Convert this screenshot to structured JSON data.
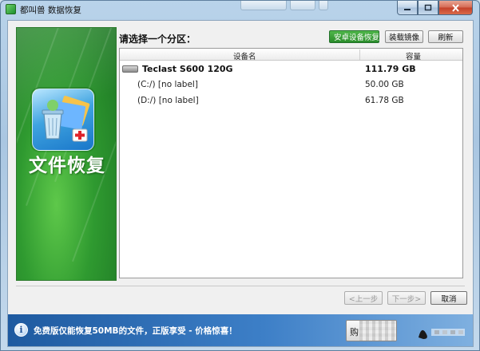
{
  "window": {
    "title": "都叫兽 数据恢复"
  },
  "sidebar": {
    "title": "文件恢复",
    "icon": "recycle-bin-folder-icon"
  },
  "panel": {
    "prompt": "请选择一个分区：",
    "buttons": {
      "android": "安卓设备恢复",
      "load_image": "装载镜像",
      "refresh": "刷新"
    },
    "columns": {
      "device": "设备名",
      "capacity": "容量"
    },
    "rows": [
      {
        "name": "Teclast S600 120G",
        "capacity": "111.79 GB",
        "kind": "disk"
      },
      {
        "name": "(C:/) [no label]",
        "capacity": "50.00 GB",
        "kind": "partition"
      },
      {
        "name": "(D:/) [no label]",
        "capacity": "61.78 GB",
        "kind": "partition"
      }
    ]
  },
  "nav": {
    "prev": "<上一步",
    "next": "下一步>",
    "cancel": "取消"
  },
  "footer": {
    "message": "免费版仅能恢复50MB的文件，正版享受 - 价格惊喜！",
    "buy_label": "购"
  },
  "colors": {
    "sidebar_green": "#2f9a30",
    "footer_blue": "#1e5aa0",
    "android_green": "#2a8c2a"
  }
}
